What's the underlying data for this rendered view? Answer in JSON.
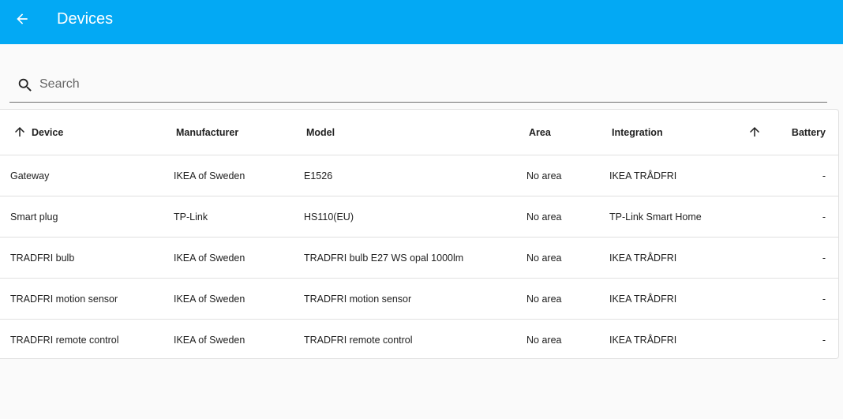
{
  "header": {
    "title": "Devices",
    "back_icon": "arrow-left-icon"
  },
  "search": {
    "placeholder": "Search",
    "value": "",
    "icon": "search-icon"
  },
  "table": {
    "columns": {
      "device": "Device",
      "manufacturer": "Manufacturer",
      "model": "Model",
      "area": "Area",
      "integration": "Integration",
      "battery": "Battery"
    },
    "sort_icon": "arrow-up-icon",
    "rows": [
      {
        "device": "Gateway",
        "manufacturer": "IKEA of Sweden",
        "model": "E1526",
        "area": "No area",
        "integration": "IKEA TRÅDFRI",
        "battery": "-"
      },
      {
        "device": "Smart plug",
        "manufacturer": "TP-Link",
        "model": "HS110(EU)",
        "area": "No area",
        "integration": "TP-Link Smart Home",
        "battery": "-"
      },
      {
        "device": "TRADFRI bulb",
        "manufacturer": "IKEA of Sweden",
        "model": "TRADFRI bulb E27 WS opal 1000lm",
        "area": "No area",
        "integration": "IKEA TRÅDFRI",
        "battery": "-"
      },
      {
        "device": "TRADFRI motion sensor",
        "manufacturer": "IKEA of Sweden",
        "model": "TRADFRI motion sensor",
        "area": "No area",
        "integration": "IKEA TRÅDFRI",
        "battery": "-"
      },
      {
        "device": "TRADFRI remote control",
        "manufacturer": "IKEA of Sweden",
        "model": "TRADFRI remote control",
        "area": "No area",
        "integration": "IKEA TRÅDFRI",
        "battery": "-"
      }
    ]
  },
  "colors": {
    "header_bg": "#03a9f4",
    "page_bg": "#fafafa",
    "divider": "#e0e0e0"
  }
}
